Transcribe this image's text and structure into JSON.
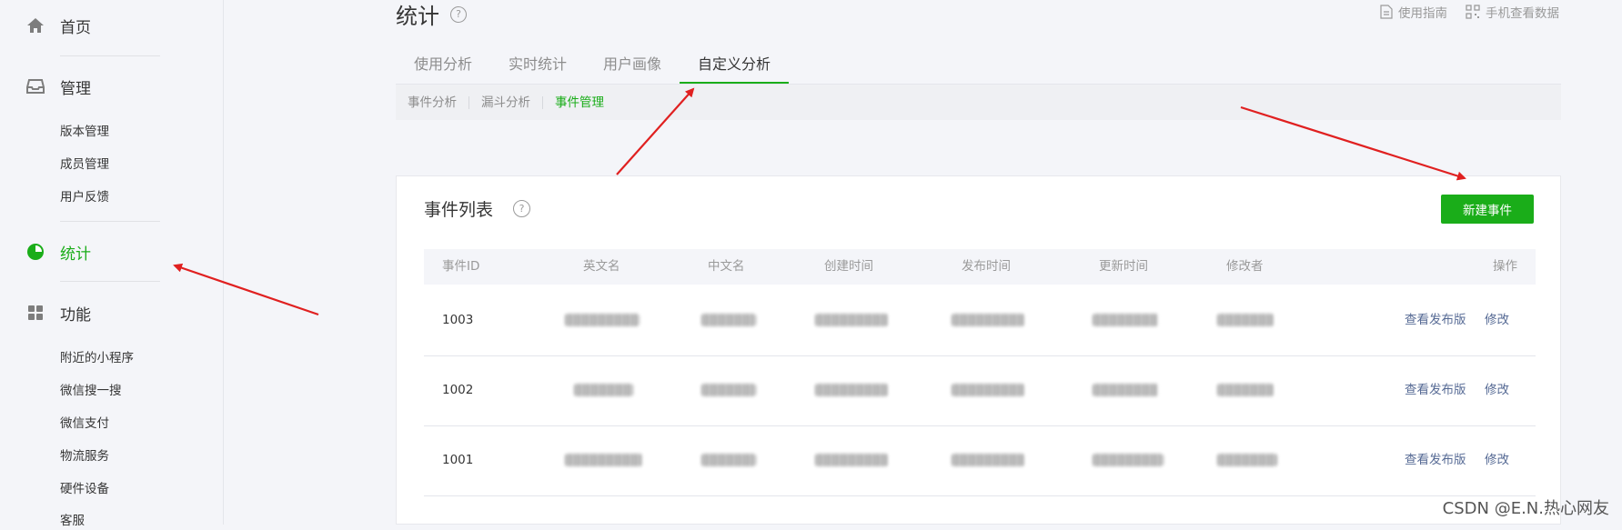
{
  "sidebar": {
    "home": {
      "label": "首页"
    },
    "manage": {
      "label": "管理",
      "items": [
        "版本管理",
        "成员管理",
        "用户反馈"
      ]
    },
    "stats": {
      "label": "统计"
    },
    "features": {
      "label": "功能",
      "items": [
        "附近的小程序",
        "微信搜一搜",
        "微信支付",
        "物流服务",
        "硬件设备",
        "客服"
      ]
    }
  },
  "header": {
    "title": "统计",
    "help": "?",
    "links": {
      "guide": "使用指南",
      "mobile": "手机查看数据"
    }
  },
  "tabs": [
    "使用分析",
    "实时统计",
    "用户画像",
    "自定义分析"
  ],
  "active_tab": "自定义分析",
  "subtabs": [
    "事件分析",
    "漏斗分析",
    "事件管理"
  ],
  "active_subtab": "事件管理",
  "card": {
    "title": "事件列表",
    "help": "?",
    "new_button": "新建事件",
    "columns": [
      "事件ID",
      "英文名",
      "中文名",
      "创建时间",
      "发布时间",
      "更新时间",
      "修改者",
      "操作"
    ],
    "rows": [
      {
        "id": "1003",
        "actions": [
          "查看发布版",
          "修改"
        ]
      },
      {
        "id": "1002",
        "actions": [
          "查看发布版",
          "修改"
        ]
      },
      {
        "id": "1001",
        "actions": [
          "查看发布版",
          "修改"
        ]
      }
    ]
  },
  "watermark": "CSDN @E.N.热心网友",
  "colors": {
    "accent": "#1aad19",
    "link": "#576b95",
    "annotation": "#e02020"
  }
}
